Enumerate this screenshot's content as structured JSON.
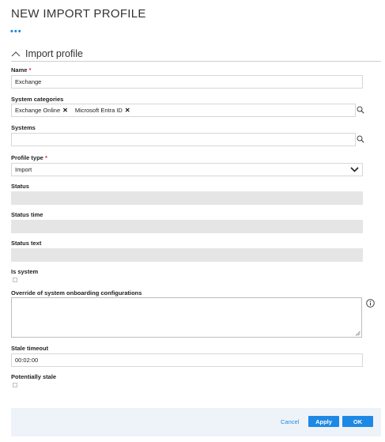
{
  "page": {
    "title": "NEW IMPORT PROFILE",
    "more_label": "•••"
  },
  "section": {
    "title": "Import profile",
    "icon": "chevron-up-icon"
  },
  "fields": {
    "name": {
      "label": "Name",
      "required": "*",
      "value": "Exchange"
    },
    "system_categories": {
      "label": "System categories",
      "chips": [
        "Exchange Online",
        "Microsoft Entra ID"
      ],
      "remove_glyph": "✕"
    },
    "systems": {
      "label": "Systems",
      "value": ""
    },
    "profile_type": {
      "label": "Profile type",
      "required": "*",
      "value": "Import"
    },
    "status": {
      "label": "Status",
      "value": ""
    },
    "status_time": {
      "label": "Status time",
      "value": ""
    },
    "status_text": {
      "label": "Status text",
      "value": ""
    },
    "is_system": {
      "label": "Is system",
      "checked": false
    },
    "override": {
      "label": "Override of system onboarding configurations",
      "value": ""
    },
    "stale_timeout": {
      "label": "Stale timeout",
      "value": "00:02:00"
    },
    "potentially_stale": {
      "label": "Potentially stale",
      "checked": false
    }
  },
  "footer": {
    "cancel_label": "Cancel",
    "apply_label": "Apply",
    "ok_label": "OK"
  },
  "colors": {
    "accent": "#1e88e5",
    "required": "#d32f2f",
    "readonly_bg": "#e5e5e5",
    "footer_bg": "#eef3f9"
  }
}
